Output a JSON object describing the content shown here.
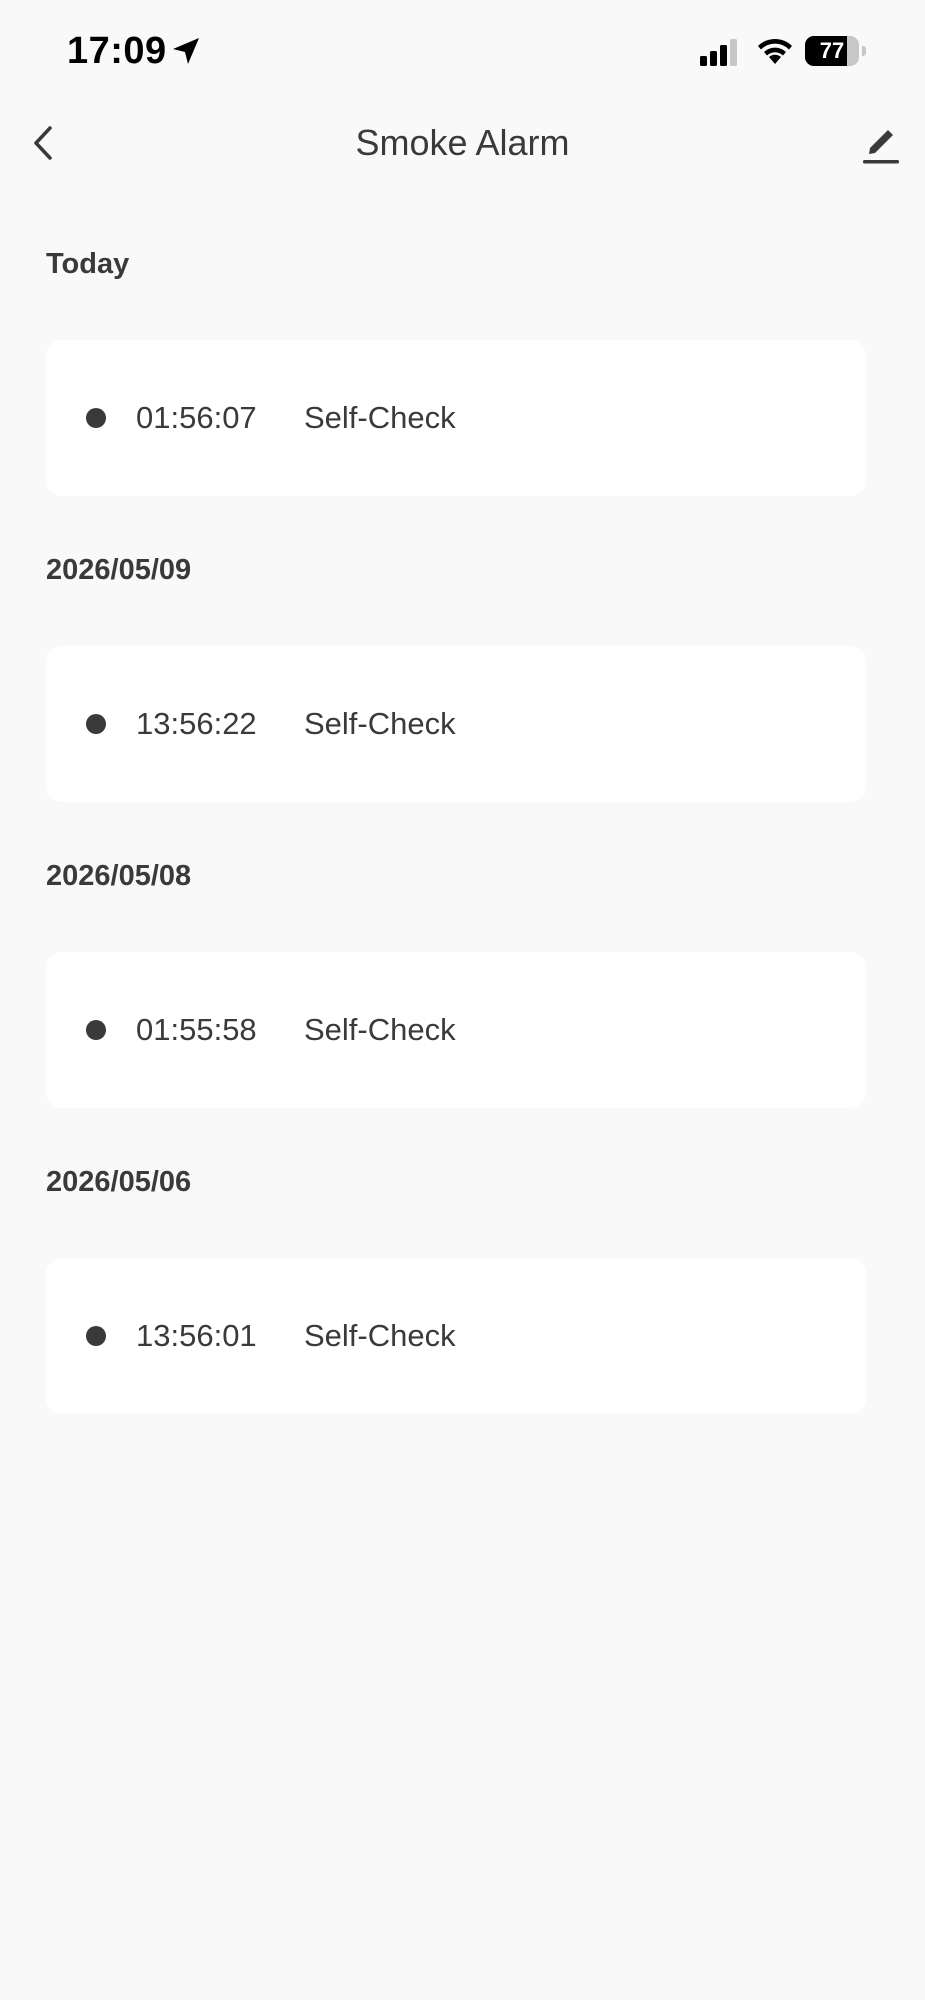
{
  "status_bar": {
    "time": "17:09",
    "battery_level": "77",
    "battery_fraction": 0.77,
    "icons": [
      "location-arrow-icon",
      "cellular-signal-icon",
      "wifi-icon",
      "battery-icon"
    ]
  },
  "header": {
    "title": "Smoke Alarm",
    "back_icon": "chevron-left-icon",
    "edit_icon": "pencil-icon"
  },
  "colors": {
    "background": "#f9f9f9",
    "card": "#ffffff",
    "text": "#3a3a3a",
    "status_text": "#000000"
  },
  "sections": [
    {
      "date": "Today",
      "records": [
        {
          "time": "01:56:07",
          "type": "Self-Check"
        }
      ]
    },
    {
      "date": "2026/05/09",
      "records": [
        {
          "time": "13:56:22",
          "type": "Self-Check"
        }
      ]
    },
    {
      "date": "2026/05/08",
      "records": [
        {
          "time": "01:55:58",
          "type": "Self-Check"
        }
      ]
    },
    {
      "date": "2026/05/06",
      "records": [
        {
          "time": "13:56:01",
          "type": "Self-Check"
        }
      ]
    }
  ]
}
